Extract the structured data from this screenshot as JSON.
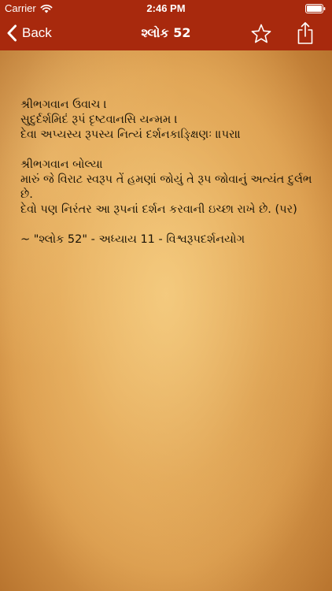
{
  "status_bar": {
    "carrier": "Carrier",
    "time": "2:46 PM"
  },
  "nav": {
    "back_label": "Back",
    "title": "શ્લોક 52"
  },
  "verse": {
    "sanskrit_speaker": "શ્રીભગવાન ઉવાચ ।",
    "sanskrit_text": "સુદુર્દર્શમિદં રૂપં દૃષ્ટવાનસિ યન્મમ  ।\nદેવા અપ્યસ્ય રૂપસ્ય નિત્યં દર્શનકાઙ્ક્ષિણઃ   ॥પર॥",
    "translation_speaker": "શ્રીભગવાન બોલ્યા",
    "translation_text": "મારું જે વિરાટ સ્વરૂપ તેં હમણાં જોયું તે રૂપ જોવાનું અત્યંત દુર્લભ છે.\nદેવો પણ નિરંતર આ રૂપનાં દર્શન કરવાની ઇચ્છા રાખે છે. (પર)",
    "reference": "~ \"શ્લોક 52\" - અધ્યાય 11 - વિશ્વરૂપદર્શનયોગ"
  },
  "colors": {
    "bar_background": "#a8290d",
    "bar_foreground": "#ffffff",
    "text": "#1a1306",
    "parchment": "#e8b463"
  },
  "icons": {
    "back": "chevron-left-icon",
    "favorite": "star-outline-icon",
    "share": "share-icon",
    "wifi": "wifi-icon",
    "battery": "battery-full-icon"
  }
}
